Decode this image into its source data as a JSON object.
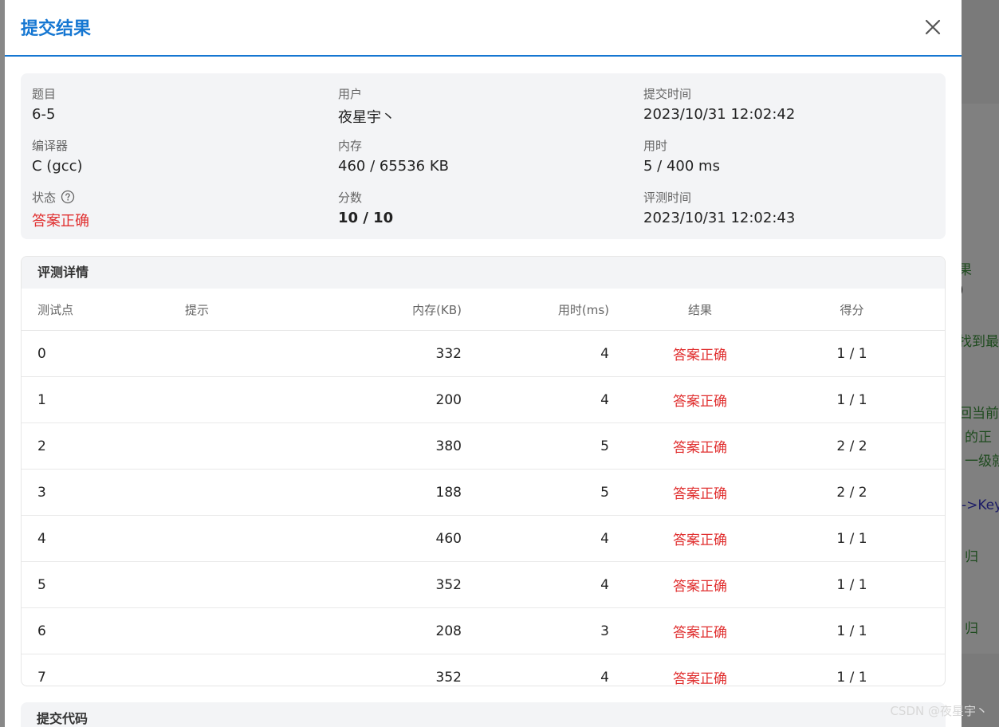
{
  "background": {
    "fragments": [
      "果",
      ")",
      "找到最",
      "回当前",
      "的正",
      "一级就",
      "->Key",
      "归",
      "归"
    ]
  },
  "watermark": "CSDN @夜星宇丶",
  "dialog": {
    "title": "提交结果",
    "info": {
      "problem_label": "题目",
      "problem": "6-5",
      "user_label": "用户",
      "user": "夜星宇丶",
      "submit_time_label": "提交时间",
      "submit_time": "2023/10/31 12:02:42",
      "compiler_label": "编译器",
      "compiler": "C (gcc)",
      "memory_label": "内存",
      "memory": "460 / 65536 KB",
      "time_label": "用时",
      "time": "5 / 400 ms",
      "status_label": "状态",
      "status": "答案正确",
      "score_label": "分数",
      "score": "10 / 10",
      "judge_time_label": "评测时间",
      "judge_time": "2023/10/31 12:02:43"
    },
    "details": {
      "title": "评测详情",
      "columns": {
        "id": "测试点",
        "hint": "提示",
        "memory": "内存(KB)",
        "time": "用时(ms)",
        "result": "结果",
        "score": "得分"
      },
      "rows": [
        {
          "id": "0",
          "hint": "",
          "memory": "332",
          "time": "4",
          "result": "答案正确",
          "score": "1 / 1"
        },
        {
          "id": "1",
          "hint": "",
          "memory": "200",
          "time": "4",
          "result": "答案正确",
          "score": "1 / 1"
        },
        {
          "id": "2",
          "hint": "",
          "memory": "380",
          "time": "5",
          "result": "答案正确",
          "score": "2 / 2"
        },
        {
          "id": "3",
          "hint": "",
          "memory": "188",
          "time": "5",
          "result": "答案正确",
          "score": "2 / 2"
        },
        {
          "id": "4",
          "hint": "",
          "memory": "460",
          "time": "4",
          "result": "答案正确",
          "score": "1 / 1"
        },
        {
          "id": "5",
          "hint": "",
          "memory": "352",
          "time": "4",
          "result": "答案正确",
          "score": "1 / 1"
        },
        {
          "id": "6",
          "hint": "",
          "memory": "208",
          "time": "3",
          "result": "答案正确",
          "score": "1 / 1"
        },
        {
          "id": "7",
          "hint": "",
          "memory": "352",
          "time": "4",
          "result": "答案正确",
          "score": "1 / 1"
        }
      ]
    },
    "code_section_title": "提交代码"
  },
  "colors": {
    "accent": "#1677d2",
    "success_text": "#e02f2f",
    "panel_bg": "#f3f4f6"
  }
}
